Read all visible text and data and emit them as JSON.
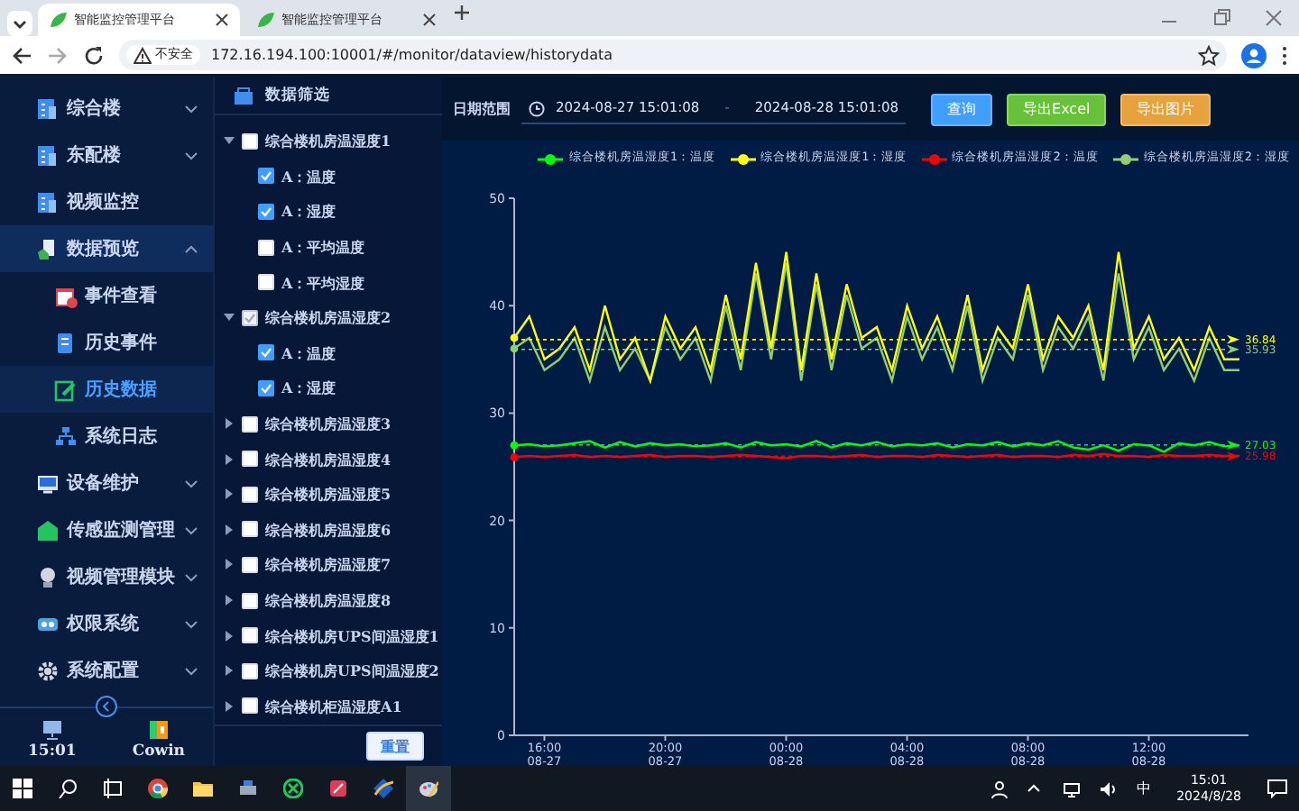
{
  "browser": {
    "tabs": [
      {
        "title": "智能监控管理平台",
        "selected": true
      },
      {
        "title": "智能监控管理平台",
        "selected": false
      }
    ],
    "security": "不安全",
    "url": "172.16.194.100:10001/#/monitor/dataview/historydata"
  },
  "sidebar": {
    "items": [
      {
        "label": "综合楼",
        "expanded": false,
        "selected": false
      },
      {
        "label": "东配楼",
        "expanded": false,
        "selected": false
      },
      {
        "label": "视频监控",
        "selected": false
      },
      {
        "label": "数据预览",
        "expanded": true,
        "selected": true,
        "children": [
          {
            "label": "事件查看",
            "selected": false
          },
          {
            "label": "历史事件",
            "selected": false
          },
          {
            "label": "历史数据",
            "selected": true
          },
          {
            "label": "系统日志",
            "selected": false
          }
        ]
      },
      {
        "label": "设备维护",
        "expanded": false,
        "selected": false
      },
      {
        "label": "传感监测管理",
        "expanded": false,
        "selected": false
      },
      {
        "label": "视频管理模块",
        "expanded": false,
        "selected": false
      },
      {
        "label": "权限系统",
        "expanded": false,
        "selected": false
      },
      {
        "label": "系统配置",
        "expanded": false,
        "selected": false
      }
    ],
    "time": "15:01",
    "user": "Cowin"
  },
  "filter": {
    "title": "数据筛选",
    "groups": [
      {
        "label": "综合楼机房温湿度1",
        "expanded": true,
        "checked": false,
        "disabled": false,
        "children": [
          {
            "label": "A：温度",
            "checked": true
          },
          {
            "label": "A：湿度",
            "checked": true
          },
          {
            "label": "A：平均温度",
            "checked": false
          },
          {
            "label": "A：平均湿度",
            "checked": false
          }
        ]
      },
      {
        "label": "综合楼机房温湿度2",
        "expanded": true,
        "checked": true,
        "disabled": true,
        "children": [
          {
            "label": "A：温度",
            "checked": true
          },
          {
            "label": "A：湿度",
            "checked": true
          }
        ]
      },
      {
        "label": "综合楼机房温湿度3",
        "expanded": false,
        "checked": false,
        "disabled": false
      },
      {
        "label": "综合楼机房温湿度4",
        "expanded": false,
        "checked": false,
        "disabled": false
      },
      {
        "label": "综合楼机房温湿度5",
        "expanded": false,
        "checked": false,
        "disabled": false
      },
      {
        "label": "综合楼机房温湿度6",
        "expanded": false,
        "checked": false,
        "disabled": false
      },
      {
        "label": "综合楼机房温湿度7",
        "expanded": false,
        "checked": false,
        "disabled": false
      },
      {
        "label": "综合楼机房温湿度8",
        "expanded": false,
        "checked": false,
        "disabled": false
      },
      {
        "label": "综合楼机房UPS间温湿度1",
        "expanded": false,
        "checked": false,
        "disabled": false
      },
      {
        "label": "综合楼机房UPS间温湿度2",
        "expanded": false,
        "checked": false,
        "disabled": false
      },
      {
        "label": "综合楼机柜温湿度A1",
        "expanded": false,
        "checked": false,
        "disabled": false
      }
    ],
    "reset": "重置"
  },
  "toolbar": {
    "date_label": "日期范围",
    "start": "2024-08-27 15:01:08",
    "separator": "-",
    "end": "2024-08-28 15:01:08",
    "buttons": [
      {
        "label": "查询",
        "kind": "primary"
      },
      {
        "label": "导出Excel",
        "kind": "success"
      },
      {
        "label": "导出图片",
        "kind": "warning"
      }
    ]
  },
  "chart_data": {
    "type": "line",
    "ylim": [
      0,
      50
    ],
    "yticks": [
      0,
      10,
      20,
      30,
      40,
      50
    ],
    "categories": [
      null,
      null,
      "16:00 08-27",
      null,
      null,
      null,
      null,
      null,
      null,
      null,
      "20:00 08-27",
      null,
      null,
      null,
      null,
      null,
      null,
      null,
      "00:00 08-28",
      null,
      null,
      null,
      null,
      null,
      null,
      null,
      "04:00 08-28",
      null,
      null,
      null,
      null,
      null,
      null,
      null,
      "08:00 08-28",
      null,
      null,
      null,
      null,
      null,
      null,
      null,
      "12:00 08-28",
      null,
      null,
      null,
      null,
      null,
      null
    ],
    "series": [
      {
        "name": "综合楼机房温湿度1：温度",
        "color": "#00ff00",
        "values": [
          27,
          27.1,
          26.9,
          27,
          27.2,
          27.4,
          26.8,
          27.3,
          26.9,
          27.2,
          27,
          27.1,
          26.9,
          27,
          27.2,
          26.8,
          27.3,
          27,
          27.1,
          26.9,
          27.4,
          26.8,
          27.2,
          27,
          27.3,
          26.9,
          27.1,
          27,
          27.2,
          26.8,
          27.1,
          27,
          27.3,
          26.9,
          27.2,
          27,
          27.4,
          26.8,
          26.6,
          27,
          26.5,
          27.1,
          27,
          26.4,
          27.2,
          27,
          27.3,
          26.9,
          27
        ]
      },
      {
        "name": "综合楼机房温湿度1：湿度",
        "color": "#ffff00",
        "values": [
          37,
          39,
          35,
          36,
          38,
          34,
          40,
          35,
          37,
          33,
          39,
          36,
          38,
          34,
          41,
          35,
          44,
          36,
          45,
          34,
          43,
          35,
          42,
          37,
          38,
          34,
          40,
          36,
          39,
          35,
          41,
          34,
          38,
          36,
          42,
          35,
          39,
          37,
          40,
          34,
          45,
          36,
          39,
          35,
          37,
          34,
          38,
          35,
          35
        ]
      },
      {
        "name": "综合楼机房温湿度2：温度",
        "color": "#ff0000",
        "values": [
          25.9,
          26,
          25.9,
          26,
          26.1,
          25.9,
          26,
          25.9,
          26,
          26.1,
          25.9,
          26,
          26,
          25.9,
          26,
          26.1,
          26,
          25.9,
          25.8,
          26,
          26,
          25.9,
          26,
          26.1,
          25.9,
          26,
          26,
          25.9,
          26.1,
          26,
          25.9,
          26,
          26.1,
          25.9,
          26,
          26,
          25.9,
          26.1,
          26,
          26.2,
          26,
          26,
          25.9,
          26.1,
          26,
          26,
          26.1,
          26,
          26
        ]
      },
      {
        "name": "综合楼机房温湿度2：湿度",
        "color": "#91cc75",
        "values": [
          36,
          37,
          34,
          35,
          37,
          33,
          38,
          34,
          36,
          33,
          38,
          35,
          37,
          33,
          40,
          34,
          43,
          35,
          44,
          33,
          42,
          34,
          41,
          36,
          37,
          33,
          39,
          35,
          38,
          34,
          40,
          33,
          37,
          35,
          41,
          34,
          38,
          36,
          39,
          33,
          43,
          35,
          38,
          34,
          36,
          33,
          37,
          34,
          34
        ]
      }
    ],
    "legend": "top-right",
    "ref_lines": [
      {
        "axis": "y",
        "value": 36.84,
        "label": "36.84",
        "color": "#ffff00"
      },
      {
        "axis": "y",
        "value": 35.93,
        "label": "35.93",
        "color": "#91cc75"
      },
      {
        "axis": "y",
        "value": 27.03,
        "label": "27.03",
        "color": "#00ff00"
      },
      {
        "axis": "y",
        "value": 25.98,
        "label": "25.98",
        "color": "#ff0000"
      }
    ]
  },
  "taskbar": {
    "ime": "中",
    "time": "15:01",
    "date": "2024/8/28"
  }
}
